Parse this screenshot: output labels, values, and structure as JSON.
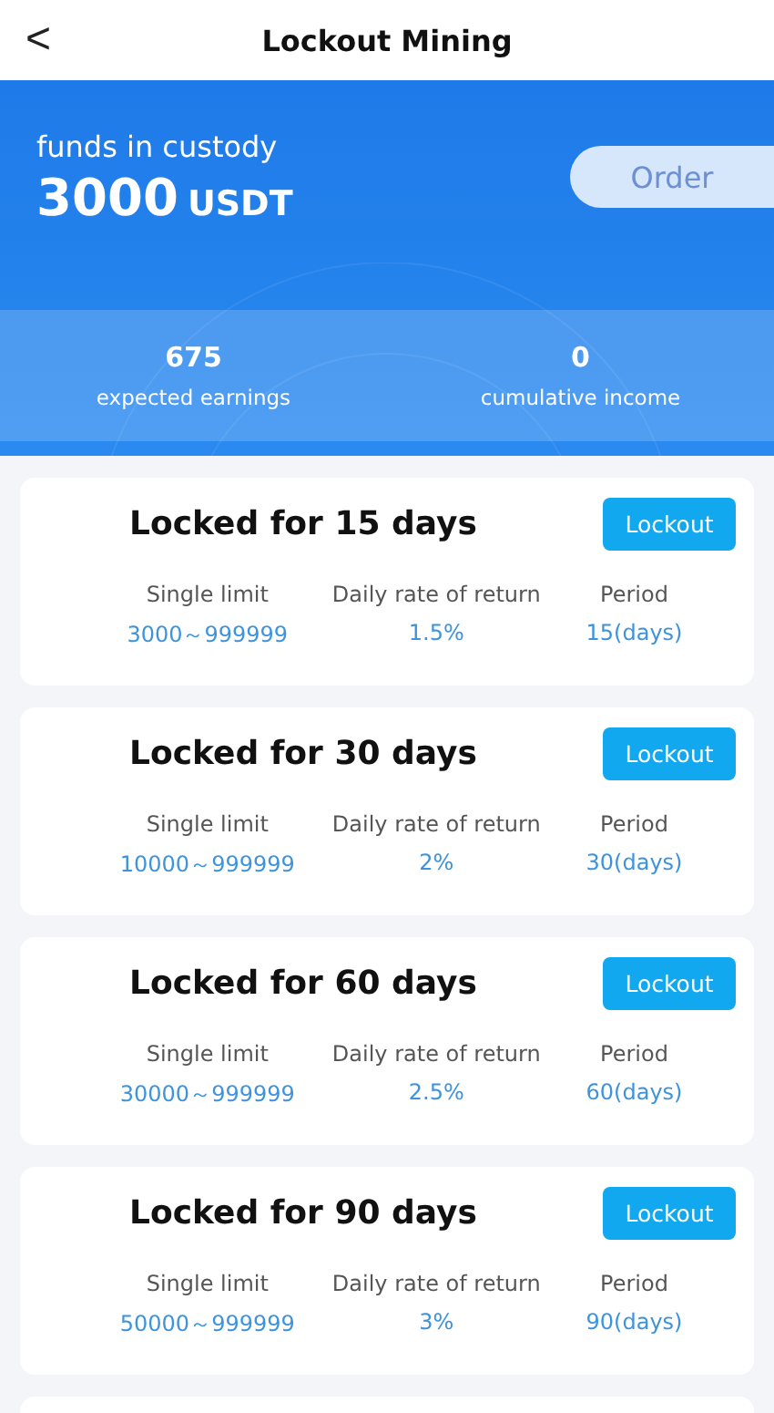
{
  "header": {
    "title": "Lockout Mining",
    "back": "<"
  },
  "summary": {
    "label": "funds in custody",
    "amount": "3000",
    "unit": "USDT",
    "order_button": "Order",
    "stats": [
      {
        "value": "675",
        "label": "expected earnings"
      },
      {
        "value": "0",
        "label": "cumulative income"
      }
    ]
  },
  "plans": [
    {
      "title": "Locked for 15 days",
      "button": "Lockout",
      "columns": [
        {
          "label": "Single limit",
          "value": "3000～999999"
        },
        {
          "label": "Daily rate of return",
          "value": "1.5%"
        },
        {
          "label": "Period",
          "value": "15(days)"
        }
      ]
    },
    {
      "title": "Locked for 30 days",
      "button": "Lockout",
      "columns": [
        {
          "label": "Single limit",
          "value": "10000～999999"
        },
        {
          "label": "Daily rate of return",
          "value": "2%"
        },
        {
          "label": "Period",
          "value": "30(days)"
        }
      ]
    },
    {
      "title": "Locked for 60 days",
      "button": "Lockout",
      "columns": [
        {
          "label": "Single limit",
          "value": "30000～999999"
        },
        {
          "label": "Daily rate of return",
          "value": "2.5%"
        },
        {
          "label": "Period",
          "value": "60(days)"
        }
      ]
    },
    {
      "title": "Locked for 90 days",
      "button": "Lockout",
      "columns": [
        {
          "label": "Single limit",
          "value": "50000～999999"
        },
        {
          "label": "Daily rate of return",
          "value": "3%"
        },
        {
          "label": "Period",
          "value": "90(days)"
        }
      ]
    }
  ]
}
